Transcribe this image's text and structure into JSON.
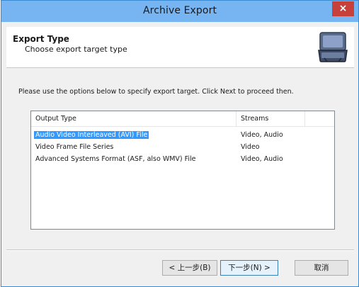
{
  "window": {
    "title": "Archive Export",
    "close_glyph": "×",
    "accent_color": "#77b4f2",
    "close_color": "#c7403a"
  },
  "header": {
    "title": "Export Type",
    "subtitle": "Choose export target type",
    "icon": "briefcase-icon"
  },
  "instructions": "Please use the options below to specify export target. Click Next to proceed then.",
  "listview": {
    "columns": [
      "Output Type",
      "Streams",
      ""
    ],
    "rows": [
      {
        "type": "Audio Video Interleaved (AVI) File",
        "streams": "Video, Audio",
        "selected": true
      },
      {
        "type": "Video Frame File Series",
        "streams": "Video",
        "selected": false
      },
      {
        "type": "Advanced Systems Format (ASF, also WMV) File",
        "streams": "Video, Audio",
        "selected": false
      }
    ],
    "selection_color": "#3399ff"
  },
  "buttons": {
    "back": "< 上一步(B)",
    "next": "下一步(N) >",
    "cancel": "取消"
  }
}
